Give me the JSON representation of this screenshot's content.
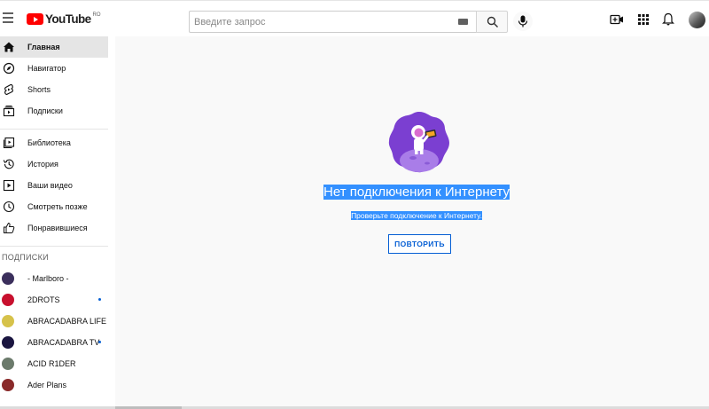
{
  "header": {
    "logo_text": "YouTube",
    "logo_region": "RO",
    "search_placeholder": "Введите запрос"
  },
  "sidebar": {
    "main_items": [
      {
        "label": "Главная",
        "icon": "home-icon",
        "active": true
      },
      {
        "label": "Навигатор",
        "icon": "compass-icon"
      },
      {
        "label": "Shorts",
        "icon": "shorts-icon"
      },
      {
        "label": "Подписки",
        "icon": "subscriptions-icon"
      }
    ],
    "library_items": [
      {
        "label": "Библиотека",
        "icon": "library-icon"
      },
      {
        "label": "История",
        "icon": "history-icon"
      },
      {
        "label": "Ваши видео",
        "icon": "your-videos-icon"
      },
      {
        "label": "Смотреть позже",
        "icon": "clock-icon"
      },
      {
        "label": "Понравившиеся",
        "icon": "like-icon"
      }
    ],
    "subscriptions_title": "ПОДПИСКИ",
    "subscriptions": [
      {
        "label": "- Marlboro -",
        "color": "#3b2f5c",
        "new": false
      },
      {
        "label": "2DROTS",
        "color": "#c8102e",
        "new": true
      },
      {
        "label": "ABRACADABRA LIFE",
        "color": "#d6c24a",
        "new": false
      },
      {
        "label": "ABRACADABRA TV",
        "color": "#1a1540",
        "new": true
      },
      {
        "label": "ACID R1DER",
        "color": "#6b7a6b",
        "new": false
      },
      {
        "label": "Ader Plans",
        "color": "#8a2a2a",
        "new": false
      }
    ]
  },
  "main": {
    "error_title": "Нет подключения к Интернету",
    "error_subtitle": "Проверьте подключение к Интернету.",
    "retry_label": "ПОВТОРИТЬ"
  },
  "colors": {
    "brand_red": "#ff0000",
    "accent_blue": "#065fd4",
    "selection_blue": "#3390ff",
    "illustration_purple": "#7b3fd1"
  }
}
